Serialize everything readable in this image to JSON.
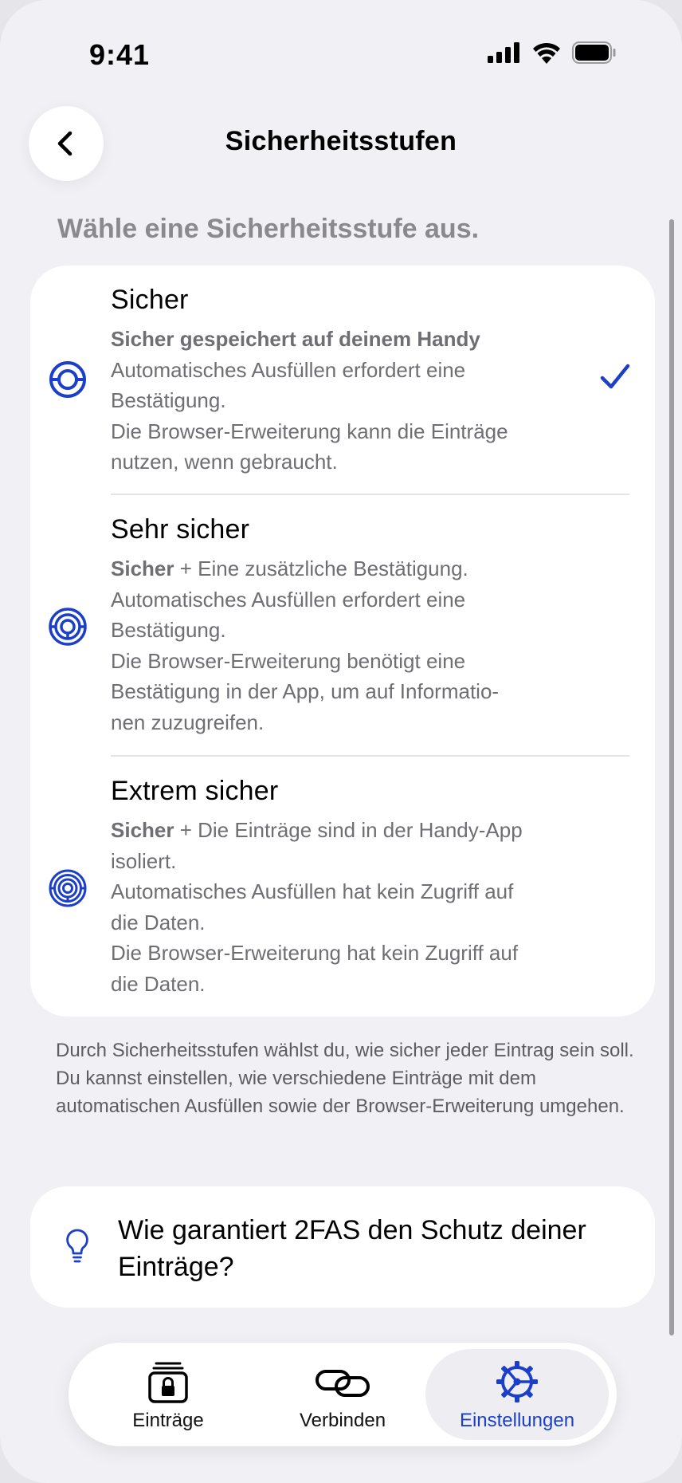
{
  "status_bar": {
    "time": "9:41"
  },
  "nav": {
    "title": "Sicherheitsstufen"
  },
  "section_header": "Wähle eine Sicherheitsstufe aus.",
  "levels": [
    {
      "title": "Sicher",
      "icon": "shield-ring-1-icon",
      "selected": true,
      "lines": [
        {
          "bold": "Sicher gespeichert auf deinem Handy",
          "text": ""
        },
        {
          "bold": "",
          "text": "Automatisches Ausfüllen erfordert eine"
        },
        {
          "bold": "",
          "text": "Bestätigung."
        },
        {
          "bold": "",
          "text": "Die Browser-Erweiterung kann die Einträge"
        },
        {
          "bold": "",
          "text": "nutzen, wenn gebraucht."
        }
      ]
    },
    {
      "title": "Sehr sicher",
      "icon": "shield-ring-2-icon",
      "selected": false,
      "lines": [
        {
          "bold": "Sicher",
          "text": " + Eine zusätzliche Bestätigung."
        },
        {
          "bold": "",
          "text": "Automatisches Ausfüllen erfordert eine"
        },
        {
          "bold": "",
          "text": "Bestätigung."
        },
        {
          "bold": "",
          "text": "Die Browser-Erweiterung benötigt eine"
        },
        {
          "bold": "",
          "text": "Bestätigung in der App, um auf Informatio-"
        },
        {
          "bold": "",
          "text": "nen zuzugreifen."
        }
      ]
    },
    {
      "title": "Extrem sicher",
      "icon": "shield-ring-3-icon",
      "selected": false,
      "lines": [
        {
          "bold": "Sicher",
          "text": " + Die Einträge sind in der Handy-App"
        },
        {
          "bold": "",
          "text": "isoliert."
        },
        {
          "bold": "",
          "text": "Automatisches Ausfüllen hat kein Zugriff auf"
        },
        {
          "bold": "",
          "text": "die Daten."
        },
        {
          "bold": "",
          "text": "Die Browser-Erweiterung hat kein Zugriff auf"
        },
        {
          "bold": "",
          "text": "die Daten."
        }
      ]
    }
  ],
  "footnote": "Durch Sicherheitsstufen wählst du, wie sicher jeder Eintrag sein soll. Du kannst einstellen, wie verschiedene Einträge mit dem automatischen Ausfüllen sowie der Browser-Erweiterung umgehen.",
  "info": {
    "text": "Wie garantiert 2FAS den Schutz deiner Einträge?",
    "icon": "lightbulb-icon"
  },
  "tabs": [
    {
      "label": "Einträge",
      "icon": "vault-lock-icon",
      "active": false
    },
    {
      "label": "Verbinden",
      "icon": "link-icon",
      "active": false
    },
    {
      "label": "Einstellungen",
      "icon": "gear-icon",
      "active": true
    }
  ],
  "colors": {
    "accent": "#1c3fc9",
    "background": "#f0f0f5",
    "card": "#ffffff",
    "secondary_text": "#6e6e73"
  }
}
